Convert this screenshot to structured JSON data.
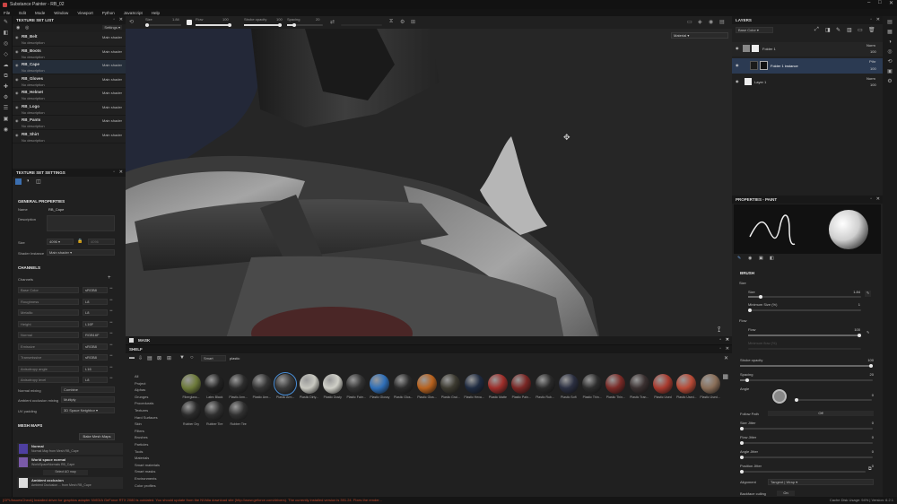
{
  "window": {
    "title": "Substance Painter - RB_02",
    "controls": [
      "–",
      "□",
      "✕"
    ]
  },
  "menu": [
    "File",
    "Edit",
    "Mode",
    "Window",
    "Viewport",
    "Python",
    "JavaScript",
    "Help"
  ],
  "toolbar": {
    "size_label": "Size",
    "size_value": "1.84",
    "flow_label": "Flow",
    "flow_value": "100",
    "stroke_opacity_label": "Stroke opacity",
    "stroke_opacity_value": "100",
    "spacing_label": "Spacing",
    "spacing_value": "20",
    "material_dropdown": "Material"
  },
  "texture_set_list": {
    "title": "TEXTURE SET LIST",
    "settings_label": "Settings",
    "items": [
      {
        "name": "RB_Belt",
        "desc": "No description",
        "shader": "Main shader"
      },
      {
        "name": "RB_Boots",
        "desc": "No description",
        "shader": "Main shader"
      },
      {
        "name": "RB_Cape",
        "desc": "No description",
        "shader": "Main shader"
      },
      {
        "name": "RB_Gloves",
        "desc": "No description",
        "shader": "Main shader"
      },
      {
        "name": "RB_Helmet",
        "desc": "No description",
        "shader": "Main shader"
      },
      {
        "name": "RB_Logo",
        "desc": "No description",
        "shader": "Main shader"
      },
      {
        "name": "RB_Pants",
        "desc": "No description",
        "shader": "Main shader"
      },
      {
        "name": "RB_Shirt",
        "desc": "No description",
        "shader": "Main shader"
      }
    ]
  },
  "texture_set_settings": {
    "title": "TEXTURE SET SETTINGS",
    "general_title": "GENERAL PROPERTIES",
    "name_label": "Name",
    "name_value": "RB_Cape",
    "description_label": "Description",
    "size_label": "Size",
    "size_value": "4096",
    "size_value2": "4096",
    "shader_label": "Shader Instance",
    "shader_value": "Main shader",
    "channels_title": "CHANNELS",
    "channels_label": "Channels",
    "channels": [
      {
        "name": "Base Color",
        "format": "sRGB8"
      },
      {
        "name": "Roughness",
        "format": "L8"
      },
      {
        "name": "Metallic",
        "format": "L8"
      },
      {
        "name": "Height",
        "format": "L16F"
      },
      {
        "name": "Normal",
        "format": "RGB16F"
      },
      {
        "name": "Emissive",
        "format": "sRGB8"
      },
      {
        "name": "Transmissive",
        "format": "sRGB8"
      },
      {
        "name": "Anisotropy angle",
        "format": "L16"
      },
      {
        "name": "Anisotropy level",
        "format": "L8"
      }
    ],
    "normal_mixing_label": "Normal mixing",
    "normal_mixing_value": "Combine",
    "ao_mixing_label": "Ambient occlusion mixing",
    "ao_mixing_value": "Multiply",
    "uv_padding_label": "UV padding",
    "uv_padding_value": "3D Space Neighbor",
    "mesh_maps_title": "MESH MAPS",
    "bake_button": "Bake Mesh Maps",
    "mesh_maps": [
      {
        "name": "Normal",
        "file": "Normal Map from Mesh RB_Cape"
      },
      {
        "name": "World space normal",
        "file": "WorldSpaceNormals RB_Cape"
      },
      {
        "name": "Ambient occlusion",
        "file": "Ambient Occlusion ... from Mesh RB_Cape"
      }
    ],
    "select_map": "Select AO map"
  },
  "viewport": {
    "mask_label": "MASK"
  },
  "shelf": {
    "title": "SHELF",
    "filter_tag": "Smart",
    "search_value": "plastic",
    "categories": [
      "All",
      "Project",
      "Alphas",
      "Grunges",
      "Procedurals",
      "Textures",
      "Hard Surfaces",
      "Skin",
      "Filters",
      "Brushes",
      "Particles",
      "Tools",
      "Materials",
      "Smart materials",
      "Smart masks",
      "Environments",
      "Color profiles"
    ],
    "materials": [
      {
        "label": "Fiberglass...",
        "color": "#6d7a3a"
      },
      {
        "label": "Latex Black",
        "color": "#222222"
      },
      {
        "label": "Plastic Arm...",
        "color": "#2c2c2c"
      },
      {
        "label": "Plastic Arm...",
        "color": "#333333"
      },
      {
        "label": "Plastic Arm...",
        "color": "#3a3a3a"
      },
      {
        "label": "Plastic Dirty...",
        "color": "#c8c8c0"
      },
      {
        "label": "Plastic Dusty",
        "color": "#d0d0c8"
      },
      {
        "label": "Plastic Fabr...",
        "color": "#333333"
      },
      {
        "label": "Plastic Glossy",
        "color": "#2f6fb8"
      },
      {
        "label": "Plastic Glos...",
        "color": "#2a2a2a"
      },
      {
        "label": "Plastic Glos...",
        "color": "#b8621e"
      },
      {
        "label": "Plastic Grai...",
        "color": "#3c3a30"
      },
      {
        "label": "Plastic Hexa...",
        "color": "#1e2a40"
      },
      {
        "label": "Plastic Matte",
        "color": "#9e2e2a"
      },
      {
        "label": "Plastic Pain...",
        "color": "#7a2624"
      },
      {
        "label": "Plastic Rub...",
        "color": "#2a2a2a"
      },
      {
        "label": "Plastic Soft",
        "color": "#2a2e40"
      },
      {
        "label": "Plastic Thin...",
        "color": "#2c2c2c"
      },
      {
        "label": "Plastic Thin...",
        "color": "#7a2a26"
      },
      {
        "label": "Plastic Tran...",
        "color": "#3a3030"
      },
      {
        "label": "Plastic Used",
        "color": "#a83a2e"
      },
      {
        "label": "Plastic Used...",
        "color": "#b84a36"
      },
      {
        "label": "Plastic Used...",
        "color": "#8a6e58"
      },
      {
        "label": "Rubber Dry",
        "color": "#2a2a2a"
      },
      {
        "label": "Rubber Tire",
        "color": "#2e2e2e"
      },
      {
        "label": "Rubber Tire",
        "color": "#303030"
      }
    ]
  },
  "layers": {
    "title": "LAYERS",
    "channel_dropdown": "Base Color",
    "items": [
      {
        "name": "Folder 1",
        "blend": "Norm",
        "opacity": "100"
      },
      {
        "name": "Folder 1 instance",
        "blend": "Pthr",
        "opacity": "100"
      },
      {
        "name": "Layer 1",
        "blend": "Norm",
        "opacity": "100"
      }
    ]
  },
  "properties": {
    "title": "PROPERTIES - PAINT",
    "brush_title": "BRUSH",
    "size_section": "Size",
    "size_label": "Size",
    "size_value": "1.84",
    "min_size_label": "Minimum Size (%)",
    "min_size_value": "1",
    "flow_section": "Flow",
    "flow_label": "Flow",
    "flow_value": "100",
    "min_flow_label": "Minimum flow (%)",
    "stroke_opacity_label": "Stroke opacity",
    "stroke_opacity_value": "100",
    "spacing_label": "Spacing",
    "spacing_value": "20",
    "angle_label": "Angle",
    "angle_value": "0",
    "follow_path_label": "Follow Path",
    "follow_path_value": "Off",
    "size_jitter_label": "Size Jitter",
    "size_jitter_value": "0",
    "flow_jitter_label": "Flow Jitter",
    "flow_jitter_value": "0",
    "angle_jitter_label": "Angle Jitter",
    "angle_jitter_value": "0",
    "position_jitter_label": "Position Jitter",
    "position_jitter_value": "0",
    "alignment_label": "Alignment",
    "alignment_value": "Tangent | Wrap",
    "backface_label": "Backface culling",
    "backface_value": "On"
  },
  "status": {
    "message": "[GPUIssuesCheck] Installed driver for graphics adapter NVIDIA GeForce RTX 2080 is outdated. You should update from the NVidia download site (http://www.geforce.com/drivers). The currently installed version is 391.24. Fixes the render...",
    "right": "Cache Disk Usage: 94% | Version: 6.2.1"
  }
}
